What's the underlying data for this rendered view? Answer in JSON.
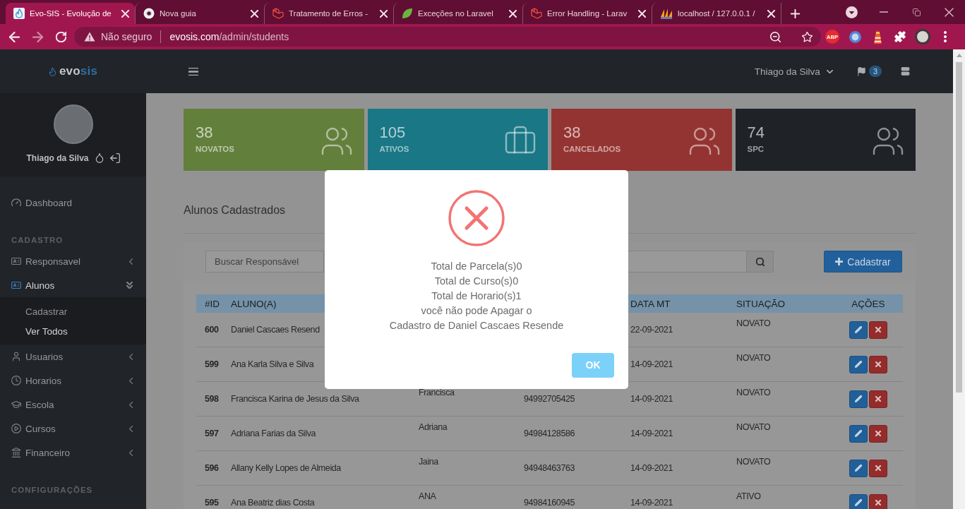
{
  "browser": {
    "tabs": [
      {
        "title": "Evo-SIS - Evolução de",
        "selected": true
      },
      {
        "title": "Nova guia",
        "selected": false
      },
      {
        "title": "Tratamento de Erros -",
        "selected": false
      },
      {
        "title": "Exceções no Laravel",
        "selected": false
      },
      {
        "title": "Error Handling - Larav",
        "selected": false
      },
      {
        "title": "localhost / 127.0.0.1 /",
        "selected": false
      }
    ],
    "security_label": "Não seguro",
    "url": {
      "host": "evosis.com",
      "path": "/admin/students"
    },
    "extension_label": "ABP"
  },
  "topbar": {
    "logo": {
      "prefix": "evo",
      "suffix": "sis"
    },
    "user_name": "Thiago da Silva",
    "notification_count": "3"
  },
  "sidebar": {
    "profile_name": "Thiago da Silva",
    "main_items": [
      {
        "label": "Dashboard",
        "selected": false
      }
    ],
    "sections": [
      {
        "title": "CADASTRO",
        "items": [
          {
            "label": "Responsavel",
            "selected": false,
            "expanded": false
          },
          {
            "label": "Alunos",
            "selected": true,
            "expanded": true,
            "children": [
              {
                "label": "Cadastrar",
                "selected": false
              },
              {
                "label": "Ver Todos",
                "selected": true
              }
            ]
          },
          {
            "label": "Usuarios",
            "selected": false,
            "expanded": false
          },
          {
            "label": "Horarios",
            "selected": false,
            "expanded": false
          },
          {
            "label": "Escola",
            "selected": false,
            "expanded": false
          },
          {
            "label": "Cursos",
            "selected": false,
            "expanded": false
          },
          {
            "label": "Financeiro",
            "selected": false,
            "expanded": false
          }
        ]
      },
      {
        "title": "CONFIGURAÇÕES"
      }
    ]
  },
  "stats": [
    {
      "value": "38",
      "label": "NOVATOS",
      "color": "#637f3c"
    },
    {
      "value": "105",
      "label": "ATIVOS",
      "color": "#1a7785"
    },
    {
      "value": "38",
      "label": "CANCELADOS",
      "color": "#943432"
    },
    {
      "value": "74",
      "label": "SPC",
      "color": "#1f2226"
    }
  ],
  "page_title": "Alunos Cadastrados",
  "search": {
    "placeholder": "Buscar Responsável",
    "add_button": "Cadastrar"
  },
  "table": {
    "columns": {
      "id": "#ID",
      "student": "ALUNO(A)",
      "date_mt": "DATA MT",
      "status": "SITUAÇÃO",
      "actions": "AÇÕES"
    },
    "rows": [
      {
        "id": "600",
        "student": "Daniel Cascaes Resend",
        "date_mt": "22-09-2021",
        "status": "NOVATO"
      },
      {
        "id": "599",
        "student": "Ana Karla Silva e Silva",
        "date_mt": "14-09-2021",
        "status": "NOVATO"
      },
      {
        "id": "598",
        "student": "Francisca Karina de Jesus da Silva",
        "column_3": "Francisca",
        "column_4": "94992705425",
        "date_mt": "14-09-2021",
        "status": "NOVATO"
      },
      {
        "id": "597",
        "student": "Adriana Farias da Silva",
        "column_3": "Adriana",
        "column_4": "94984128586",
        "date_mt": "14-09-2021",
        "status": "NOVATO"
      },
      {
        "id": "596",
        "student": "Allany Kelly Lopes de Almeida",
        "column_3": "Jaina",
        "column_4": "94948463763",
        "date_mt": "14-09-2021",
        "status": "NOVATO"
      },
      {
        "id": "595",
        "student": "Ana Beatriz dias Costa",
        "column_3": "ANA",
        "column_4": "94984160945",
        "date_mt": "14-09-2021",
        "status": "ATIVO"
      }
    ]
  },
  "dialog": {
    "message_lines": [
      "Total de Parcela(s)0",
      "Total de Curso(s)0",
      "Total de Horario(s)1",
      "você não pode Apagar o",
      "Cadastro de Daniel Cascaes Resende"
    ],
    "confirm_button": "OK"
  }
}
